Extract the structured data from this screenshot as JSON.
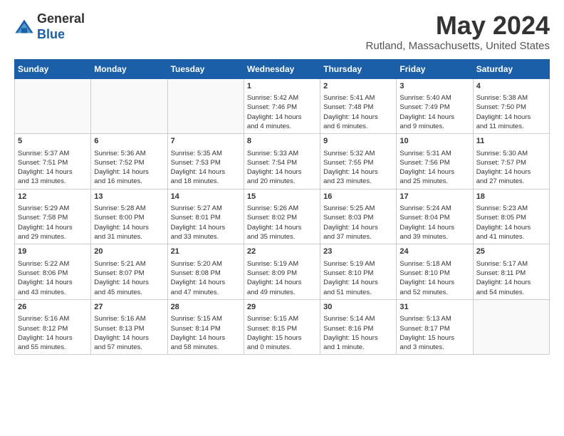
{
  "header": {
    "logo_general": "General",
    "logo_blue": "Blue",
    "month_year": "May 2024",
    "location": "Rutland, Massachusetts, United States"
  },
  "weekdays": [
    "Sunday",
    "Monday",
    "Tuesday",
    "Wednesday",
    "Thursday",
    "Friday",
    "Saturday"
  ],
  "weeks": [
    [
      {
        "day": "",
        "empty": true
      },
      {
        "day": "",
        "empty": true
      },
      {
        "day": "",
        "empty": true
      },
      {
        "day": "1",
        "info": "Sunrise: 5:42 AM\nSunset: 7:46 PM\nDaylight: 14 hours\nand 4 minutes."
      },
      {
        "day": "2",
        "info": "Sunrise: 5:41 AM\nSunset: 7:48 PM\nDaylight: 14 hours\nand 6 minutes."
      },
      {
        "day": "3",
        "info": "Sunrise: 5:40 AM\nSunset: 7:49 PM\nDaylight: 14 hours\nand 9 minutes."
      },
      {
        "day": "4",
        "info": "Sunrise: 5:38 AM\nSunset: 7:50 PM\nDaylight: 14 hours\nand 11 minutes."
      }
    ],
    [
      {
        "day": "5",
        "info": "Sunrise: 5:37 AM\nSunset: 7:51 PM\nDaylight: 14 hours\nand 13 minutes."
      },
      {
        "day": "6",
        "info": "Sunrise: 5:36 AM\nSunset: 7:52 PM\nDaylight: 14 hours\nand 16 minutes."
      },
      {
        "day": "7",
        "info": "Sunrise: 5:35 AM\nSunset: 7:53 PM\nDaylight: 14 hours\nand 18 minutes."
      },
      {
        "day": "8",
        "info": "Sunrise: 5:33 AM\nSunset: 7:54 PM\nDaylight: 14 hours\nand 20 minutes."
      },
      {
        "day": "9",
        "info": "Sunrise: 5:32 AM\nSunset: 7:55 PM\nDaylight: 14 hours\nand 23 minutes."
      },
      {
        "day": "10",
        "info": "Sunrise: 5:31 AM\nSunset: 7:56 PM\nDaylight: 14 hours\nand 25 minutes."
      },
      {
        "day": "11",
        "info": "Sunrise: 5:30 AM\nSunset: 7:57 PM\nDaylight: 14 hours\nand 27 minutes."
      }
    ],
    [
      {
        "day": "12",
        "info": "Sunrise: 5:29 AM\nSunset: 7:58 PM\nDaylight: 14 hours\nand 29 minutes."
      },
      {
        "day": "13",
        "info": "Sunrise: 5:28 AM\nSunset: 8:00 PM\nDaylight: 14 hours\nand 31 minutes."
      },
      {
        "day": "14",
        "info": "Sunrise: 5:27 AM\nSunset: 8:01 PM\nDaylight: 14 hours\nand 33 minutes."
      },
      {
        "day": "15",
        "info": "Sunrise: 5:26 AM\nSunset: 8:02 PM\nDaylight: 14 hours\nand 35 minutes."
      },
      {
        "day": "16",
        "info": "Sunrise: 5:25 AM\nSunset: 8:03 PM\nDaylight: 14 hours\nand 37 minutes."
      },
      {
        "day": "17",
        "info": "Sunrise: 5:24 AM\nSunset: 8:04 PM\nDaylight: 14 hours\nand 39 minutes."
      },
      {
        "day": "18",
        "info": "Sunrise: 5:23 AM\nSunset: 8:05 PM\nDaylight: 14 hours\nand 41 minutes."
      }
    ],
    [
      {
        "day": "19",
        "info": "Sunrise: 5:22 AM\nSunset: 8:06 PM\nDaylight: 14 hours\nand 43 minutes."
      },
      {
        "day": "20",
        "info": "Sunrise: 5:21 AM\nSunset: 8:07 PM\nDaylight: 14 hours\nand 45 minutes."
      },
      {
        "day": "21",
        "info": "Sunrise: 5:20 AM\nSunset: 8:08 PM\nDaylight: 14 hours\nand 47 minutes."
      },
      {
        "day": "22",
        "info": "Sunrise: 5:19 AM\nSunset: 8:09 PM\nDaylight: 14 hours\nand 49 minutes."
      },
      {
        "day": "23",
        "info": "Sunrise: 5:19 AM\nSunset: 8:10 PM\nDaylight: 14 hours\nand 51 minutes."
      },
      {
        "day": "24",
        "info": "Sunrise: 5:18 AM\nSunset: 8:10 PM\nDaylight: 14 hours\nand 52 minutes."
      },
      {
        "day": "25",
        "info": "Sunrise: 5:17 AM\nSunset: 8:11 PM\nDaylight: 14 hours\nand 54 minutes."
      }
    ],
    [
      {
        "day": "26",
        "info": "Sunrise: 5:16 AM\nSunset: 8:12 PM\nDaylight: 14 hours\nand 55 minutes."
      },
      {
        "day": "27",
        "info": "Sunrise: 5:16 AM\nSunset: 8:13 PM\nDaylight: 14 hours\nand 57 minutes."
      },
      {
        "day": "28",
        "info": "Sunrise: 5:15 AM\nSunset: 8:14 PM\nDaylight: 14 hours\nand 58 minutes."
      },
      {
        "day": "29",
        "info": "Sunrise: 5:15 AM\nSunset: 8:15 PM\nDaylight: 15 hours\nand 0 minutes."
      },
      {
        "day": "30",
        "info": "Sunrise: 5:14 AM\nSunset: 8:16 PM\nDaylight: 15 hours\nand 1 minute."
      },
      {
        "day": "31",
        "info": "Sunrise: 5:13 AM\nSunset: 8:17 PM\nDaylight: 15 hours\nand 3 minutes."
      },
      {
        "day": "",
        "empty": true
      }
    ]
  ]
}
